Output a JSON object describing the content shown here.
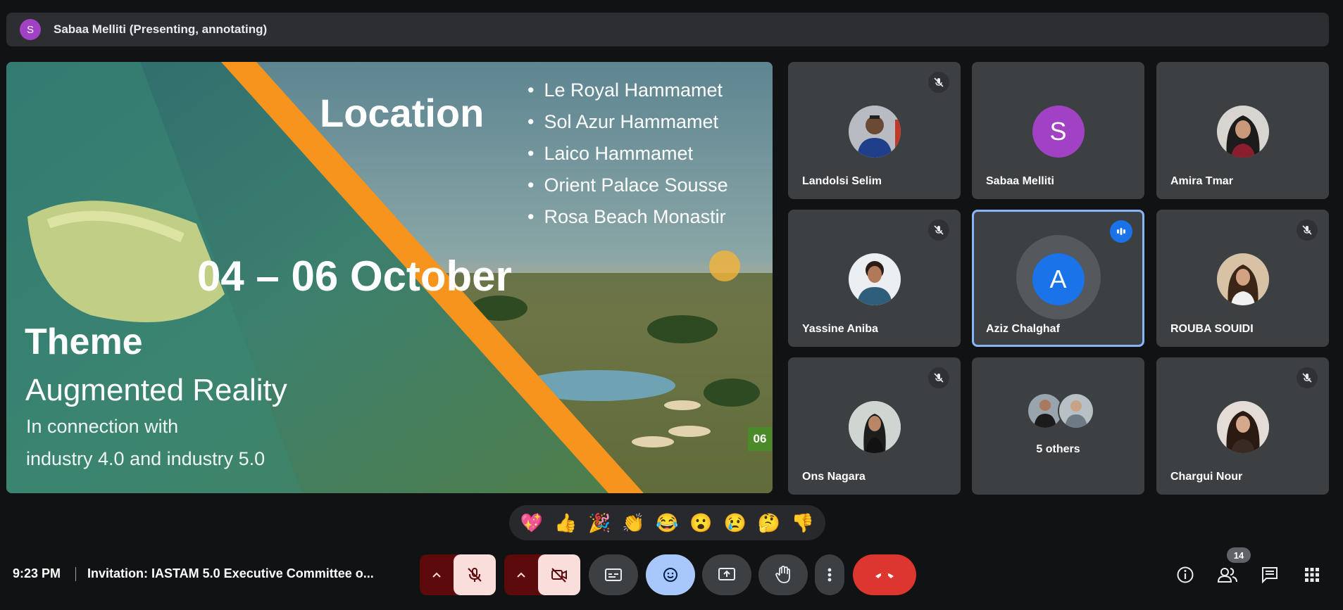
{
  "presenter": {
    "avatar_letter": "S",
    "label": "Sabaa Melliti (Presenting, annotating)"
  },
  "slide": {
    "location_title": "Location",
    "locations": [
      "Le Royal Hammamet",
      "Sol Azur Hammamet",
      "Laico Hammamet",
      "Orient Palace Sousse",
      "Rosa Beach Monastir"
    ],
    "date": "04 – 06 October",
    "theme_title": "Theme",
    "theme_subtitle": "Augmented Reality",
    "theme_caption_1": "In connection with",
    "theme_caption_2": "industry 4.0 and industry 5.0",
    "page_number": "06",
    "accent_color": "#f7941d"
  },
  "participants": [
    {
      "name": "Landolsi Selim",
      "muted": true
    },
    {
      "name": "Sabaa Melliti",
      "avatar_letter": "S",
      "avatar_color": "#a142c4",
      "muted": false
    },
    {
      "name": "Amira Tmar",
      "muted": false
    },
    {
      "name": "Yassine Aniba",
      "muted": true
    },
    {
      "name": "Aziz Chalghaf",
      "avatar_letter": "A",
      "avatar_color": "#1a73e8",
      "speaking": true
    },
    {
      "name": "ROUBA SOUIDI",
      "muted": true
    },
    {
      "name": "Ons Nagara",
      "muted": true
    },
    {
      "name": "5 others"
    },
    {
      "name": "Chargui Nour",
      "muted": true
    }
  ],
  "reactions": [
    "💖",
    "👍",
    "🎉",
    "👏",
    "😂",
    "😮",
    "😢",
    "🤔",
    "👎"
  ],
  "bottom_bar": {
    "time": "9:23 PM",
    "meeting_title": "Invitation: IASTAM 5.0 Executive Committee o...",
    "participant_count": "14"
  },
  "colors": {
    "background": "#111214",
    "tile": "#3c4043",
    "end_call": "#dc362e",
    "active_border": "#8ab4f8"
  }
}
